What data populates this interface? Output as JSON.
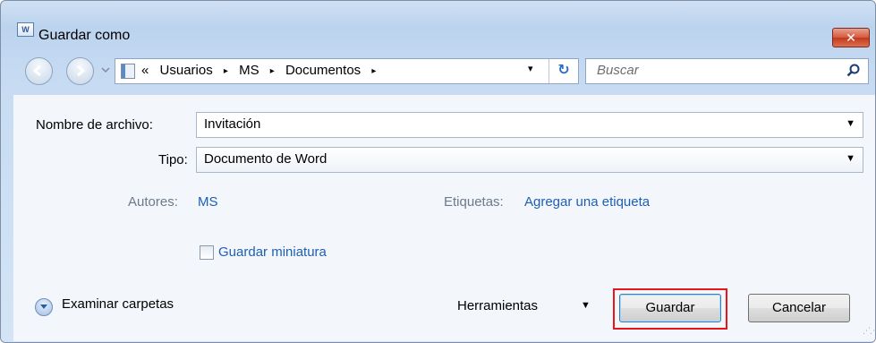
{
  "window": {
    "title": "Guardar como",
    "app_icon_text": "W",
    "close_label": "✕"
  },
  "nav": {
    "breadcrumb_prefix": "«",
    "breadcrumbs": [
      "Usuarios",
      "MS",
      "Documentos"
    ],
    "breadcrumb_separator": "▸",
    "address_dropdown": "▾",
    "refresh_label": "↻",
    "search_placeholder": "Buscar"
  },
  "form": {
    "filename_label": "Nombre de archivo:",
    "filename_value": "Invitación",
    "type_label": "Tipo:",
    "type_value": "Documento de Word",
    "dropdown_caret": "▼"
  },
  "metadata": {
    "authors_label": "Autores:",
    "authors_value": "MS",
    "tags_label": "Etiquetas:",
    "tags_value": "Agregar una etiqueta"
  },
  "options": {
    "thumbnail_label": "Guardar miniatura",
    "thumbnail_checked": false
  },
  "footer": {
    "browse_label": "Examinar carpetas",
    "tools_label": "Herramientas",
    "tools_caret": "▼",
    "save_label": "Guardar",
    "cancel_label": "Cancelar",
    "highlight_color": "#e8151b"
  }
}
